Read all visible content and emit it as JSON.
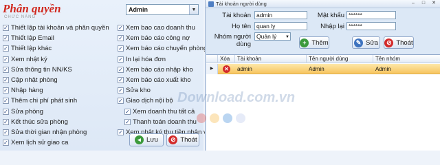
{
  "permissions_panel": {
    "title": "Phân quyền",
    "subtitle": "CHỨC NĂNG",
    "group_value": "Admin",
    "left_column": [
      {
        "label": "Thiết lập tài khoản và phân quyền",
        "checked": true
      },
      {
        "label": "Thiết lập Email",
        "checked": true
      },
      {
        "label": "Thiết lập khác",
        "checked": true
      },
      {
        "label": "Xem nhật ký",
        "checked": true
      },
      {
        "label": "Sửa thông tin NN/KS",
        "checked": true
      },
      {
        "label": "Cập nhật phòng",
        "checked": true
      },
      {
        "label": "Nhập hàng",
        "checked": true
      },
      {
        "label": "Thêm chi phí phát sinh",
        "checked": true
      },
      {
        "label": "Sửa phòng",
        "checked": true
      },
      {
        "label": "Kết thúc sửa phòng",
        "checked": true
      },
      {
        "label": "Sửa thời gian nhận phòng",
        "checked": true
      },
      {
        "label": "Xem lịch sử giao ca",
        "checked": true
      }
    ],
    "right_column": [
      {
        "label": "Xem bao cao doanh thu",
        "checked": true
      },
      {
        "label": "Xem báo cáo công nợ",
        "checked": true
      },
      {
        "label": "Xem báo cáo chuyển phòng",
        "checked": true
      },
      {
        "label": "In lại hóa đơn",
        "checked": true
      },
      {
        "label": "Xem báo cáo nhập kho",
        "checked": true
      },
      {
        "label": "Xem báo cáo xuất kho",
        "checked": true
      },
      {
        "label": "Sửa kho",
        "checked": true
      },
      {
        "label": "Giao dịch nội bộ",
        "checked": true
      },
      {
        "label": "Xem doanh thu tất cả",
        "checked": true
      },
      {
        "label": "Thanh toán doanh thu",
        "checked": true
      },
      {
        "label": "Xem nhật ký thu tiền nhân viên",
        "checked": true
      }
    ],
    "save_label": "Lưu",
    "exit_label": "Thoát"
  },
  "account_window": {
    "title": "Tài khoản người dùng",
    "fields": {
      "username_label": "Tài khoản",
      "username_value": "admin",
      "password_label": "Mật khẩu",
      "password_value": "******",
      "fullname_label": "Họ tên",
      "fullname_value": "quan ly",
      "repassword_label": "Nhập lại",
      "repassword_value": "******",
      "group_label": "Nhóm người dùng",
      "group_value": "Quản lý"
    },
    "buttons": {
      "add_label": "Thêm",
      "edit_label": "Sửa",
      "exit_label": "Thoát"
    },
    "grid": {
      "columns": [
        "Xóa",
        "Tài khoản",
        "Tên người dùng",
        "Tên nhóm"
      ],
      "rows": [
        {
          "account": "admin",
          "user_name": "Admin",
          "group_name": "Admin"
        }
      ]
    }
  },
  "watermark_text": "Download.com.vn",
  "colors": {
    "title_red": "#d0281e",
    "row_highlight": "#f7c45f",
    "dots": [
      "#e6534a",
      "#f6b53d",
      "#3a86d8",
      "#b6c6ea"
    ]
  }
}
